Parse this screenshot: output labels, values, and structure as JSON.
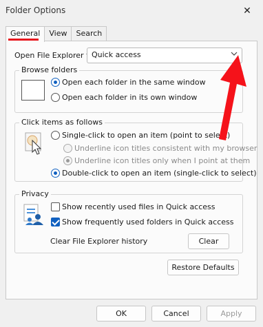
{
  "window": {
    "title": "Folder Options",
    "close_glyph": "✕"
  },
  "tabs": [
    {
      "label": "General",
      "active": true
    },
    {
      "label": "View",
      "active": false
    },
    {
      "label": "Search",
      "active": false
    }
  ],
  "open_file_explorer": {
    "label": "Open File Explorer to:",
    "value": "Quick access"
  },
  "browse_folders": {
    "title": "Browse folders",
    "options": [
      {
        "label": "Open each folder in the same window",
        "selected": true
      },
      {
        "label": "Open each folder in its own window",
        "selected": false
      }
    ]
  },
  "click_items": {
    "title": "Click items as follows",
    "single_click": {
      "label": "Single-click to open an item (point to select)",
      "selected": false
    },
    "sub_options": [
      {
        "label": "Underline icon titles consistent with my browser",
        "selected": false,
        "disabled": true
      },
      {
        "label": "Underline icon titles only when I point at them",
        "selected": true,
        "disabled": true
      }
    ],
    "double_click": {
      "label": "Double-click to open an item (single-click to select)",
      "selected": true
    }
  },
  "privacy": {
    "title": "Privacy",
    "options": [
      {
        "label": "Show recently used files in Quick access",
        "checked": false
      },
      {
        "label": "Show frequently used folders in Quick access",
        "checked": true
      }
    ],
    "clear_history_label": "Clear File Explorer history",
    "clear_button": "Clear"
  },
  "buttons": {
    "restore_defaults": "Restore Defaults",
    "ok": "OK",
    "cancel": "Cancel",
    "apply": "Apply"
  },
  "colors": {
    "accent": "#1060c0",
    "annotation": "#e8161c"
  },
  "icons": {
    "close": "close-icon",
    "dropdown": "chevron-down-icon",
    "browse": "window-icon",
    "click": "pointer-icon",
    "privacy": "folder-people-icon"
  }
}
